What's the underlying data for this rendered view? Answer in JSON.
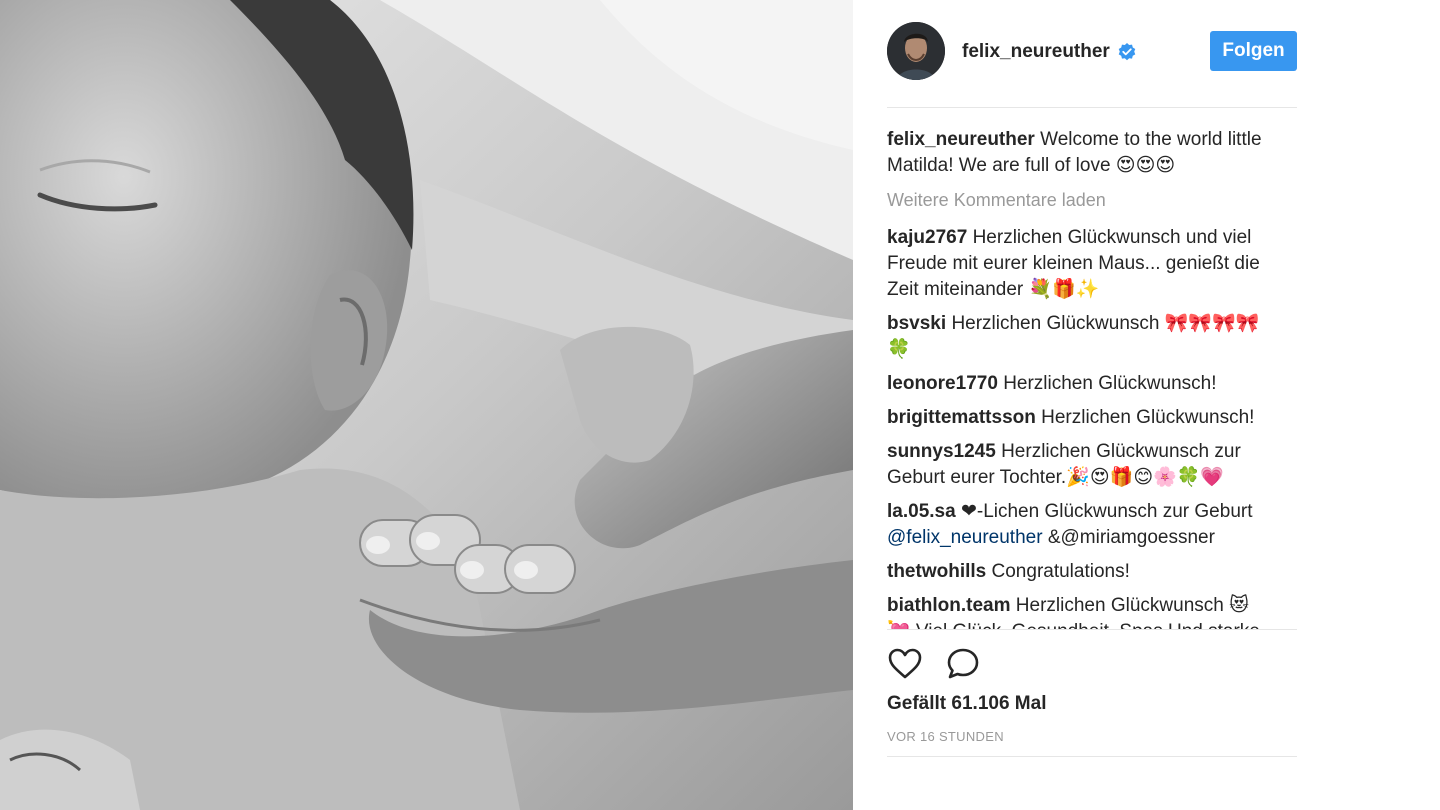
{
  "post": {
    "image_description_icon": "photo-bw-newborn",
    "author": {
      "username": "felix_neureuther",
      "verified_icon": "verified-badge-icon",
      "follow_label": "Folgen"
    },
    "caption": {
      "user": "felix_neureuther",
      "text": "Welcome to the world little Matilda! We are full of love 😍😍😍"
    },
    "load_more_label": "Weitere Kommentare laden",
    "comments": [
      {
        "user": "kaju2767",
        "text": "Herzlichen Glückwunsch und viel Freude mit eurer kleinen Maus... genießt die Zeit miteinander 💐🎁✨"
      },
      {
        "user": "bsvski",
        "text": "Herzlichen Glückwunsch 🎀🎀🎀🎀🍀"
      },
      {
        "user": "leonore1770",
        "text": "Herzlichen Glückwunsch!"
      },
      {
        "user": "brigittemattsson",
        "text": "Herzlichen Glückwunsch!"
      },
      {
        "user": "sunnys1245",
        "text": "Herzlichen Glückwunsch zur Geburt eurer Tochter.🎉😍🎁😊🌸🍀💗"
      },
      {
        "user": "la.05.sa",
        "text_pre": "❤-Lichen Glückwunsch zur Geburt ",
        "mention": "@felix_neureuther",
        "text_post": " &@miriamgoessner"
      },
      {
        "user": "thetwohills",
        "text": "Congratulations!"
      },
      {
        "user": "biathlon.team",
        "text": "Herzlichen Glückwunsch 😻💘 Viel Glück, Gesundheit, Spas Und starke Nerven 👶🎀🎀"
      }
    ],
    "actions": {
      "like_icon": "heart-icon",
      "comment_icon": "comment-bubble-icon"
    },
    "likes_label": "Gefällt 61.106 Mal",
    "timestamp": "VOR 16 STUNDEN",
    "colors": {
      "follow_button": "#3897f0",
      "mention": "#003569",
      "secondary_text": "#999999"
    }
  }
}
